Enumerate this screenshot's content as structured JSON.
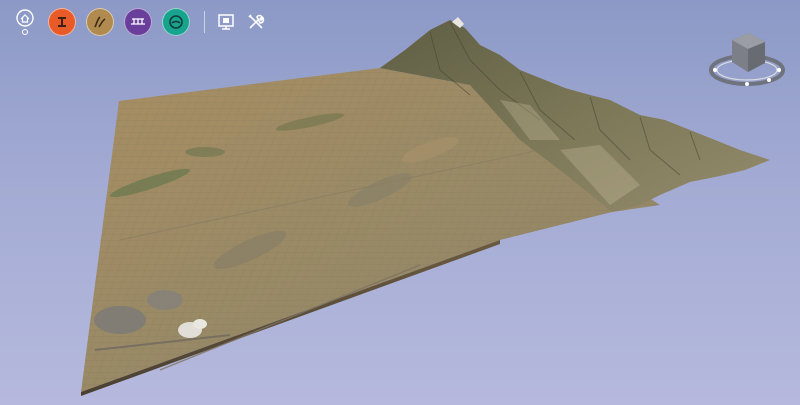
{
  "toolbar": {
    "buttons": [
      {
        "name": "home-icon",
        "color": "#ffffff"
      },
      {
        "name": "explore-icon",
        "color": "#e95a29"
      },
      {
        "name": "terrain-icon",
        "color": "#b08a4e"
      },
      {
        "name": "network-icon",
        "color": "#6a3f9c"
      },
      {
        "name": "water-icon",
        "color": "#17a38e"
      },
      {
        "name": "presentation-icon",
        "color": "#ffffff"
      },
      {
        "name": "tools-icon",
        "color": "#ffffff"
      }
    ]
  },
  "scene": {
    "sky_top": "#8c99c6",
    "sky_bottom": "#b6b9dd",
    "terrain_color": "#9c8660",
    "mountain_color": "#6d6a4c"
  },
  "navcube": {
    "cube_color": "#7c7f87",
    "ring_color": "#6e737d"
  }
}
